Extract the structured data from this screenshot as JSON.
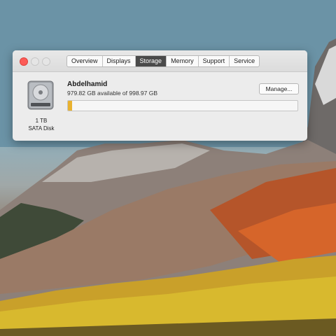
{
  "window": {
    "tabs": [
      {
        "label": "Overview",
        "active": false
      },
      {
        "label": "Displays",
        "active": false
      },
      {
        "label": "Storage",
        "active": true
      },
      {
        "label": "Memory",
        "active": false
      },
      {
        "label": "Support",
        "active": false
      },
      {
        "label": "Service",
        "active": false
      }
    ]
  },
  "disk": {
    "icon": "hard-drive-icon",
    "capacity": "1 TB",
    "type": "SATA Disk"
  },
  "volume": {
    "name": "Abdelhamid",
    "free_text": "979.82 GB available of 998.97 GB",
    "used_fraction": 0.019,
    "used_color": "#e9b22f",
    "manage_label": "Manage..."
  },
  "colors": {
    "close_button": "#fc5b57",
    "active_tab": "#4a4a4a"
  }
}
